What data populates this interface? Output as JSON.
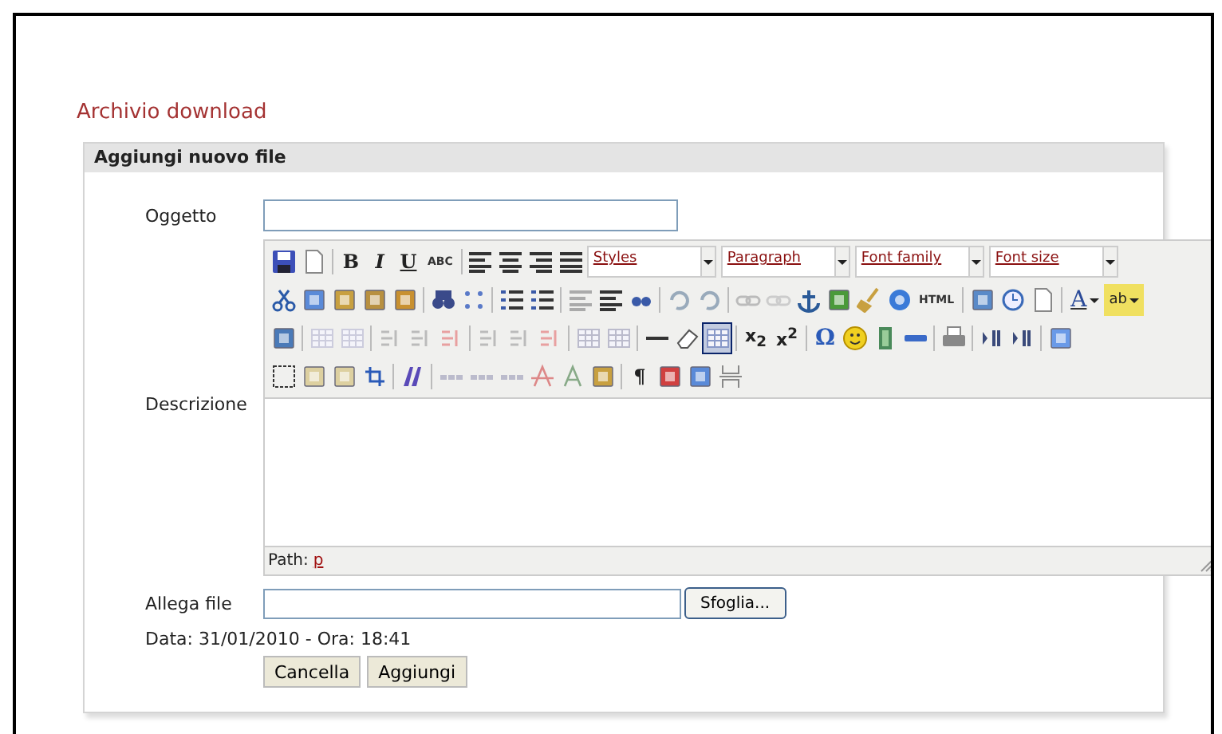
{
  "page_title": "Archivio download",
  "panel": {
    "title": "Aggiungi nuovo file"
  },
  "form": {
    "subject_label": "Oggetto",
    "description_label": "Descrizione",
    "attach_label": "Allega file",
    "browse_button": "Sfoglia...",
    "date_line": "Data: 31/01/2010 - Ora: 18:41",
    "buttons": [
      "Cancella",
      "Aggiungi"
    ]
  },
  "editor": {
    "glyphs": [
      {
        "text": "B",
        "kind": "bold"
      },
      {
        "text": "I",
        "kind": "italic"
      },
      {
        "text": "U",
        "kind": "underline"
      },
      {
        "text": "ABC",
        "kind": "small"
      },
      {
        "text": "HTML",
        "kind": "small"
      },
      {
        "text": "A",
        "kind": "color"
      },
      {
        "text": "ab",
        "kind": "highlight"
      },
      {
        "text": "x$_{2}$",
        "kind": "script"
      },
      {
        "text": "x$^{2}$",
        "kind": "script"
      },
      {
        "text": "Ω",
        "kind": "symbol"
      },
      {
        "text": "¶",
        "kind": "bold"
      }
    ],
    "selects": [
      "Styles",
      "Paragraph",
      "Font family",
      "Font size"
    ],
    "visual_aid_selected": true,
    "path_label": "Path:",
    "path_link": "p"
  }
}
